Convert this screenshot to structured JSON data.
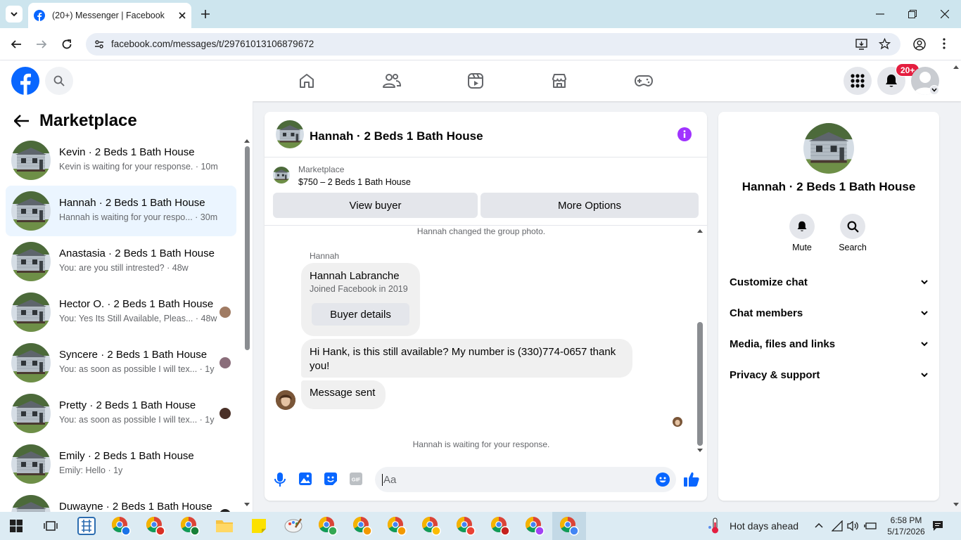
{
  "browser": {
    "tab_title": "(20+) Messenger | Facebook",
    "url": "facebook.com/messages/t/29761013106879672"
  },
  "header": {
    "notification_count": "20+"
  },
  "sidebar": {
    "title": "Marketplace",
    "conversations": [
      {
        "name": "Kevin · 2 Beds 1 Bath House",
        "preview": "Kevin is waiting for your response.",
        "time": "10m",
        "selected": false
      },
      {
        "name": "Hannah · 2 Beds 1 Bath House",
        "preview": "Hannah is waiting for your respo...",
        "time": "30m",
        "selected": true
      },
      {
        "name": "Anastasia · 2 Beds 1 Bath House",
        "preview": "You: are you still intrested?",
        "time": "48w",
        "selected": false
      },
      {
        "name": "Hector O. · 2 Beds 1 Bath House",
        "preview": "You: Yes Its Still Available, Pleas...",
        "time": "48w",
        "selected": false
      },
      {
        "name": "Syncere · 2 Beds 1 Bath House",
        "preview": "You: as soon as possible I will tex...",
        "time": "1y",
        "selected": false
      },
      {
        "name": "Pretty · 2 Beds 1 Bath House",
        "preview": "You: as soon as possible I will tex...",
        "time": "1y",
        "selected": false
      },
      {
        "name": "Emily · 2 Beds 1 Bath House",
        "preview": "Emily: Hello",
        "time": "1y",
        "selected": false
      },
      {
        "name": "Duwayne · 2 Beds 1 Bath House",
        "preview": "",
        "time": "",
        "selected": false
      }
    ]
  },
  "chat": {
    "title": "Hannah · 2 Beds 1 Bath House",
    "listing_label": "Marketplace",
    "listing_detail": "$750 – 2 Beds 1 Bath House",
    "view_buyer": "View buyer",
    "more_options": "More Options",
    "system_photo": "Hannah changed the group photo.",
    "sender": "Hannah",
    "card_name": "Hannah Labranche",
    "card_sub": "Joined Facebook in 2019",
    "buyer_details": "Buyer details",
    "message1": "Hi Hank, is this still available? My number is (330)774-0657 thank you!",
    "message2": "Message sent",
    "waiting": "Hannah is waiting for your response.",
    "input_placeholder": "Aa"
  },
  "rpanel": {
    "name": "Hannah · 2 Beds 1 Bath House",
    "mute": "Mute",
    "search": "Search",
    "rows": [
      "Customize chat",
      "Chat members",
      "Media, files and links",
      "Privacy & support"
    ]
  },
  "taskbar": {
    "weather": "Hot days ahead",
    "time": "6:58 PM",
    "date": "5/17/2026"
  },
  "colors": {
    "fb_blue": "#0866ff",
    "messenger_accent": "#a033ff",
    "badge_red": "#e41e3f"
  }
}
